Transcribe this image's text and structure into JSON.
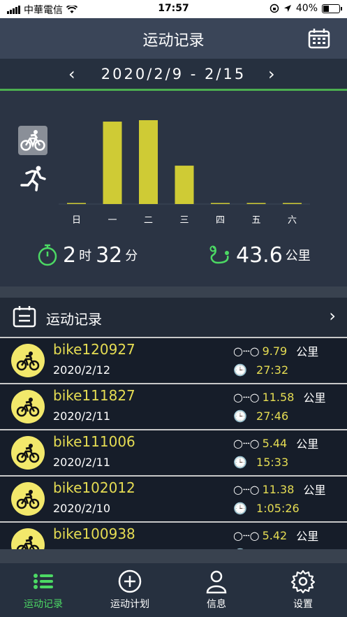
{
  "status_bar": {
    "carrier": "中華電信",
    "time": "17:57",
    "battery": "40%",
    "battery_level": 0.4
  },
  "header": {
    "title": "运动记录",
    "calendar_icon": "calendar-icon"
  },
  "week": {
    "range": "2020/2/9 - 2/15",
    "prev": "‹",
    "next": "›"
  },
  "sports": [
    "bike-icon",
    "run-icon"
  ],
  "chart_data": {
    "type": "bar",
    "categories": [
      "日",
      "一",
      "二",
      "三",
      "四",
      "五",
      "六"
    ],
    "values": [
      0,
      11.6,
      11.8,
      5.4,
      0,
      0,
      0
    ],
    "color": "#cfcb35"
  },
  "summary": {
    "hours": "2",
    "hours_unit": "时",
    "minutes": "32",
    "minutes_unit": "分",
    "distance": "43.6",
    "distance_unit": "公里"
  },
  "records_header": {
    "label": "运动记录"
  },
  "records": [
    {
      "name": "bike120927",
      "date": "2020/2/12",
      "distance": "9.79",
      "unit": "公里",
      "duration": "27:32"
    },
    {
      "name": "bike111827",
      "date": "2020/2/11",
      "distance": "11.58",
      "unit": "公里",
      "duration": "27:46"
    },
    {
      "name": "bike111006",
      "date": "2020/2/11",
      "distance": "5.44",
      "unit": "公里",
      "duration": "15:33"
    },
    {
      "name": "bike102012",
      "date": "2020/2/10",
      "distance": "11.38",
      "unit": "公里",
      "duration": "1:05:26"
    },
    {
      "name": "bike100938",
      "date": "",
      "distance": "5.42",
      "unit": "公里",
      "duration": ""
    }
  ],
  "tabs": [
    {
      "label": "运动记录",
      "icon": "list-icon",
      "active": true
    },
    {
      "label": "运动计划",
      "icon": "add-circle-icon",
      "active": false
    },
    {
      "label": "信息",
      "icon": "user-icon",
      "active": false
    },
    {
      "label": "设置",
      "icon": "gear-icon",
      "active": false
    }
  ],
  "colors": {
    "accent_green": "#4cd964",
    "bar_yellow": "#cfcb35",
    "name_yellow": "#e6dd53"
  }
}
